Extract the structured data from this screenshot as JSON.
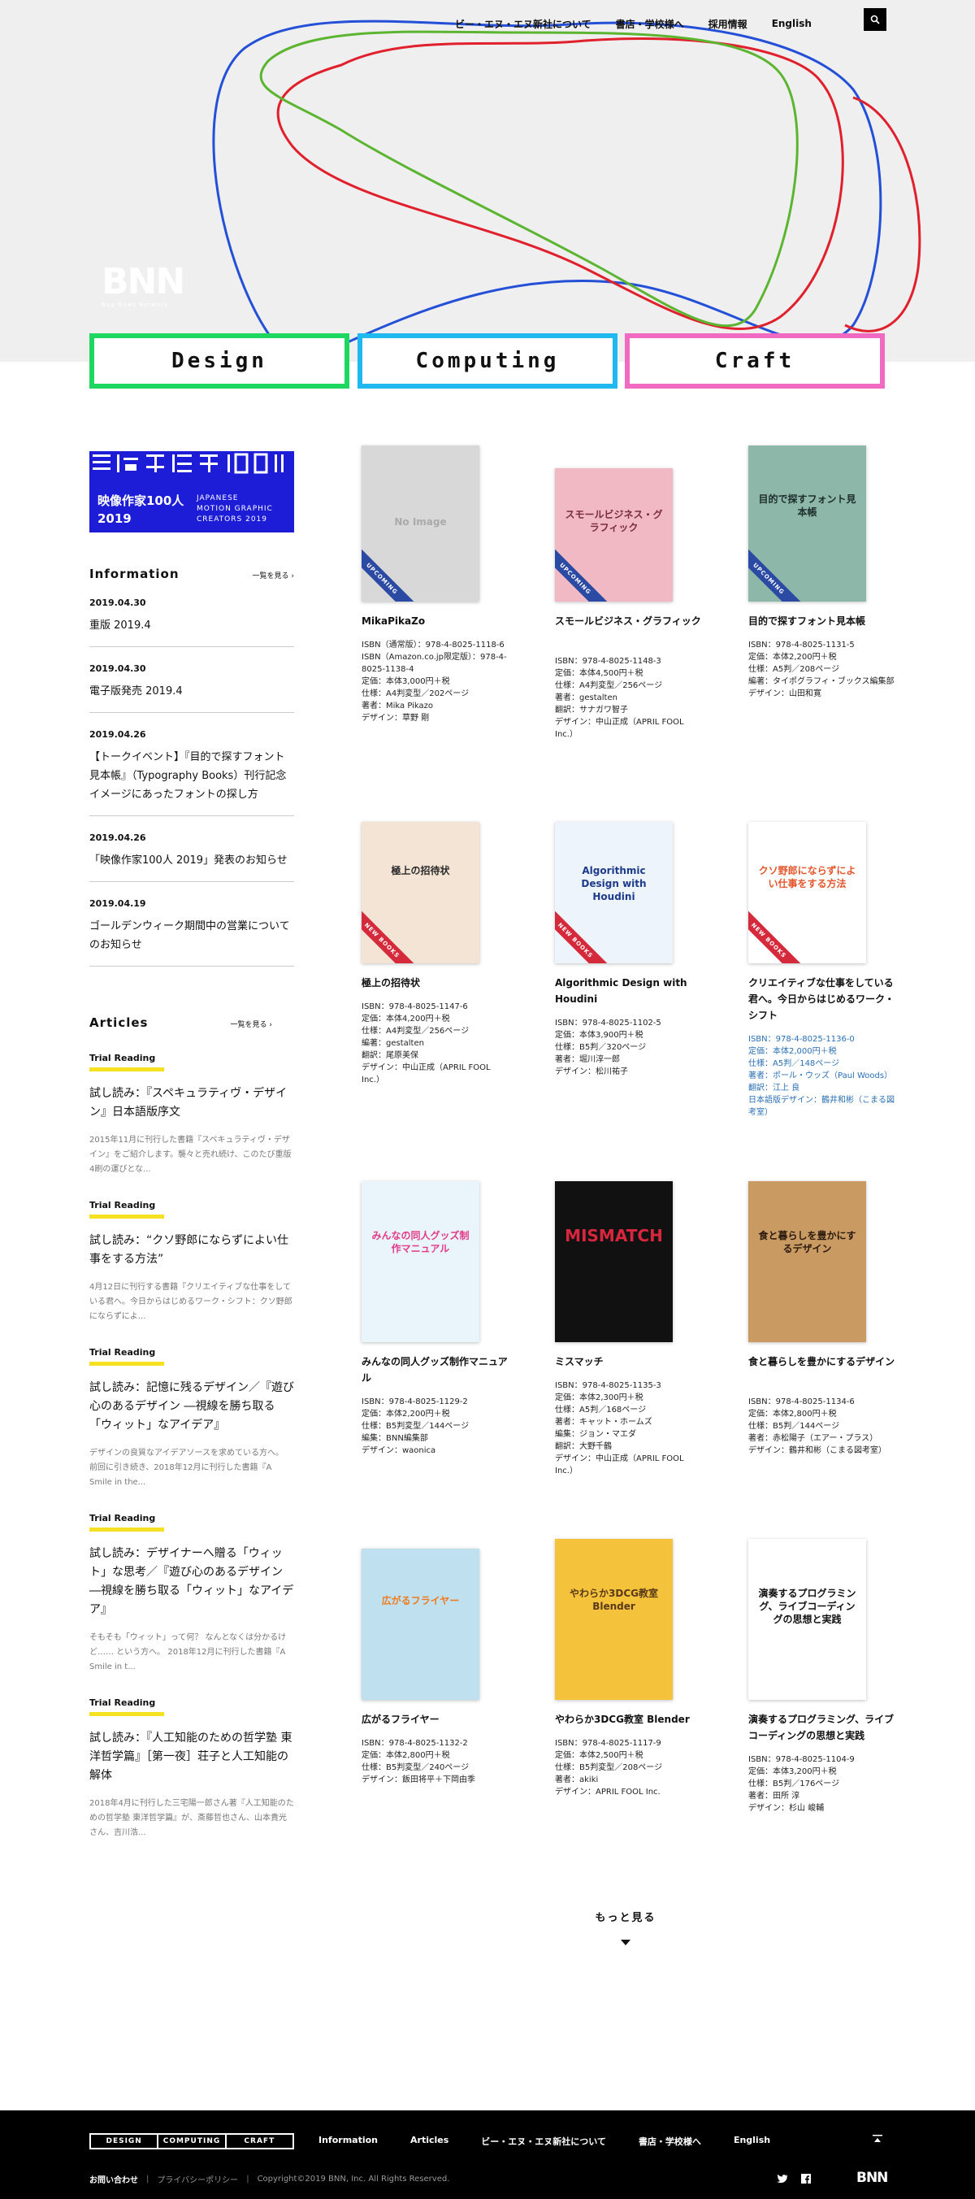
{
  "nav": {
    "links": [
      "ビー・エヌ・エヌ新社について",
      "書店・学校様へ",
      "採用情報",
      "English"
    ]
  },
  "logo": {
    "text": "BNN",
    "sub": "Bug News Network"
  },
  "categories": [
    {
      "label": "Design",
      "color": "#1ed760"
    },
    {
      "label": "Computing",
      "color": "#1fb8ef"
    },
    {
      "label": "Craft",
      "color": "#f06ac1"
    }
  ],
  "banner": {
    "jp1": "映像作家100人",
    "jp2": "2019",
    "en1": "JAPANESE",
    "en2": "MOTION GRAPHIC",
    "en3": "CREATORS 2019"
  },
  "information": {
    "heading": "Information",
    "more": "一覧を見る ›",
    "items": [
      {
        "date": "2019.04.30",
        "title": "重版 2019.4"
      },
      {
        "date": "2019.04.30",
        "title": "電子版発売 2019.4"
      },
      {
        "date": "2019.04.26",
        "title": "【トークイベント】『目的で探すフォント見本帳』（Typography Books）刊行記念 イメージにあったフォントの探し方"
      },
      {
        "date": "2019.04.26",
        "title": "「映像作家100人 2019」発表のお知らせ"
      },
      {
        "date": "2019.04.19",
        "title": "ゴールデンウィーク期間中の営業についてのお知らせ"
      }
    ]
  },
  "articles": {
    "heading": "Articles",
    "more": "一覧を見る ›",
    "items": [
      {
        "tag": "Trial Reading",
        "title": "試し読み：『スペキュラティヴ・デザイン』日本語版序文",
        "excerpt": "2015年11月に刊行した書籍『スペキュラティヴ・デザイン』をご紹介します。襲々と売れ続け、このたび重版4刷の運びとな..."
      },
      {
        "tag": "Trial Reading",
        "title": "試し読み：“クソ野郎にならずによい仕事をする方法”",
        "excerpt": "4月12日に刊行する書籍『クリエイティブな仕事をしている君へ。今日からはじめるワーク・シフト：クソ野郎にならずによ..."
      },
      {
        "tag": "Trial Reading",
        "title": "試し読み：記憶に残るデザイン／『遊び心のあるデザイン ―視線を勝ち取る「ウィット」なアイデア』",
        "excerpt": "デザインの良質なアイデアソースを求めている方へ。\n前回に引き続き、2018年12月に刊行した書籍『A Smile in the..."
      },
      {
        "tag": "Trial Reading",
        "title": "試し読み：デザイナーへ贈る「ウィット」な思考／『遊び心のあるデザイン ―視線を勝ち取る「ウィット」なアイデア』",
        "excerpt": "そもそも「ウィット」って何？ なんとなくは分かるけど…… という方へ。\n2018年12月に刊行した書籍『A Smile in t..."
      },
      {
        "tag": "Trial Reading",
        "title": "試し読み：『人工知能のための哲学塾 東洋哲学篇』［第一夜］荘子と人工知能の解体",
        "excerpt": "2018年4月に刊行した三宅陽一郎さん著『人工知能のための哲学塾 東洋哲学篇』が、斎藤哲也さん、山本貴光さん、吉川浩..."
      }
    ]
  },
  "books": [
    {
      "title": "MikaPikaZo",
      "ribbon": "UPCOMING",
      "cover": "No Image",
      "meta": [
        "ISBN（通常版）：978-4-8025-1118-6",
        "ISBN（Amazon.co.jp限定版）：978-4-8025-1138-4",
        "定価：本体3,000円＋税",
        "仕様：A4判変型／202ページ",
        "著者：Mika Pikazo",
        "デザイン：草野 剛"
      ]
    },
    {
      "title": "スモールビジネス・グラフィック",
      "ribbon": "UPCOMING",
      "cover": "スモールビジネス・グラフィック",
      "meta": [
        "ISBN：978-4-8025-1148-3",
        "定価：本体4,500円＋税",
        "仕様：A4判変型／256ページ",
        "著者：gestalten",
        "翻訳：サナガワ智子",
        "デザイン：中山正成（APRIL FOOL Inc.）"
      ]
    },
    {
      "title": "目的で探すフォント見本帳",
      "ribbon": "UPCOMING",
      "cover": "目的で探すフォント見本帳",
      "meta": [
        "ISBN：978-4-8025-1131-5",
        "定価：本体2,200円＋税",
        "仕様：A5判／208ページ",
        "編著：タイポグラフィ・ブックス編集部",
        "デザイン：山田和寛"
      ]
    },
    {
      "title": "極上の招待状",
      "ribbon": "NEW BOOKS",
      "cover": "極上の招待状",
      "meta": [
        "ISBN：978-4-8025-1147-6",
        "定価：本体4,200円＋税",
        "仕様：A4判変型／256ページ",
        "編著：gestalten",
        "翻訳：尾原美保",
        "デザイン：中山正成（APRIL FOOL Inc.）"
      ]
    },
    {
      "title": "Algorithmic Design with Houdini",
      "ribbon": "NEW BOOKS",
      "cover": "Algorithmic Design with Houdini",
      "meta": [
        "ISBN：978-4-8025-1102-5",
        "定価：本体3,900円＋税",
        "仕様：B5判／320ページ",
        "著者：堀川淳一郎",
        "デザイン：松川祐子"
      ]
    },
    {
      "title": "クリエイティブな仕事をしている君へ。今日からはじめるワーク・シフト",
      "ribbon": "NEW BOOKS",
      "cover": "クソ野郎にならずによい仕事をする方法",
      "blue": true,
      "meta": [
        "ISBN：978-4-8025-1136-0",
        "定価：本体2,000円＋税",
        "仕様：A5判／148ページ",
        "著者：ポール・ウッズ（Paul Woods）",
        "翻訳：江上 良",
        "日本語版デザイン：鶴井和彬（こまる図考室）"
      ]
    },
    {
      "title": "みんなの同人グッズ制作マニュアル",
      "ribbon": "",
      "cover": "みんなの同人グッズ制作マニュアル",
      "meta": [
        "ISBN：978-4-8025-1129-2",
        "定価：本体2,200円＋税",
        "仕様：B5判変型／144ページ",
        "編集：BNN編集部",
        "デザイン：waonica"
      ]
    },
    {
      "title": "ミスマッチ",
      "ribbon": "",
      "cover": "MISMATCH",
      "meta": [
        "ISBN：978-4-8025-1135-3",
        "定価：本体2,300円＋税",
        "仕様：A5判／168ページ",
        "著者：キャット・ホームズ",
        "編集：ジョン・マエダ",
        "翻訳：大野千鶴",
        "デザイン：中山正成（APRIL FOOL Inc.）"
      ]
    },
    {
      "title": "食と暮らしを豊かにするデザイン",
      "ribbon": "",
      "cover": "食と暮らしを豊かにするデザイン",
      "meta": [
        "ISBN：978-4-8025-1134-6",
        "定価：本体2,800円＋税",
        "仕様：B5判／144ページ",
        "著者：赤松陽子（エアー・プラス）",
        "デザイン：鶴井和彬（こまる図考室）"
      ]
    },
    {
      "title": "広がるフライヤー",
      "ribbon": "",
      "cover": "広がるフライヤー",
      "meta": [
        "ISBN：978-4-8025-1132-2",
        "定価：本体2,800円＋税",
        "仕様：B5判変型／240ページ",
        "デザイン：飯田将平＋下岡由季"
      ]
    },
    {
      "title": "やわらか3DCG教室 Blender",
      "ribbon": "",
      "cover": "やわらか3DCG教室 Blender",
      "meta": [
        "ISBN：978-4-8025-1117-9",
        "定価：本体2,500円＋税",
        "仕様：B5判変型／208ページ",
        "著者：akiki",
        "デザイン：APRIL FOOL Inc."
      ]
    },
    {
      "title": "演奏するプログラミング、ライブコーディングの思想と実践",
      "ribbon": "",
      "cover": "演奏するプログラミング、ライブコーディングの思想と実践",
      "meta": [
        "ISBN：978-4-8025-1104-9",
        "定価：本体3,200円＋税",
        "仕様：B5判／176ページ",
        "著者：田所 淳",
        "デザイン：杉山 峻輔"
      ]
    }
  ],
  "more": "もっと見る",
  "footer": {
    "cats": [
      "DESIGN",
      "COMPUTING",
      "CRAFT"
    ],
    "nav": [
      "Information",
      "Articles",
      "ビー・エヌ・エヌ新社について",
      "書店・学校様へ",
      "English"
    ],
    "contact": "お問い合わせ",
    "privacy": "プライバシーポリシー",
    "copyright": "Copyright©2019 BNN, Inc. All Rights Reserved.",
    "logo": "BNN"
  }
}
